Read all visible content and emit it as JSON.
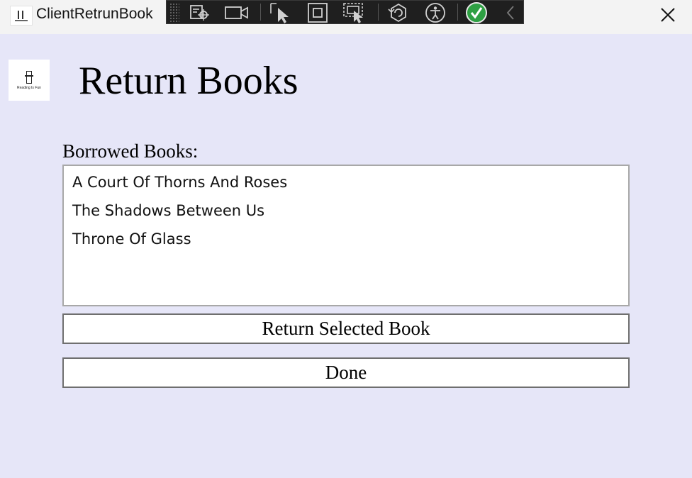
{
  "window": {
    "title": "ClientRetrunBook",
    "close_icon": "close-icon"
  },
  "devtools_toolbar": {
    "buttons": [
      "select-element-icon",
      "video-camera-icon",
      "pointer-select-icon",
      "layout-adorner-icon",
      "track-focus-icon",
      "hot-reload-icon",
      "accessibility-icon",
      "checkmark-icon",
      "collapse-chevron-icon"
    ]
  },
  "header": {
    "logo_text": "Reading Is Fun",
    "title": "Return Books"
  },
  "borrowed": {
    "label": "Borrowed Books:",
    "items": [
      "A Court Of Thorns And Roses",
      "The Shadows Between Us",
      "Throne Of Glass"
    ]
  },
  "actions": {
    "return_label": "Return Selected Book",
    "done_label": "Done"
  },
  "colors": {
    "window_background": "#e6e6f8",
    "titlebar_background": "#f3f3f3",
    "toolbar_background": "#1f1f1f",
    "check_green": "#2ea043"
  }
}
